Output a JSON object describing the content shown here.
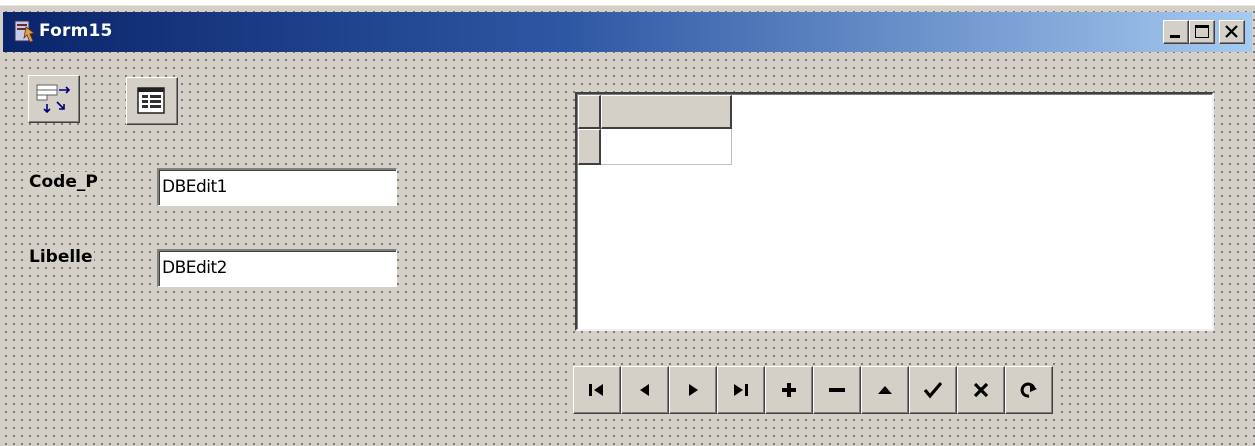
{
  "window": {
    "title": "Form15",
    "caption_buttons": [
      "minimize-icon",
      "maximize-icon",
      "close-icon"
    ]
  },
  "toolbar": {
    "icons": [
      "reorder-fields-icon",
      "table-view-icon"
    ]
  },
  "fields": [
    {
      "label": "Code_P",
      "value": "DBEdit1"
    },
    {
      "label": "Libelle",
      "value": "DBEdit2"
    }
  ],
  "grid": {
    "columns": [
      ""
    ],
    "rows": [
      [
        ""
      ]
    ]
  },
  "navigator": {
    "buttons": [
      {
        "action": "first",
        "icon": "first-record-icon"
      },
      {
        "action": "prior",
        "icon": "prior-record-icon"
      },
      {
        "action": "next",
        "icon": "next-record-icon"
      },
      {
        "action": "last",
        "icon": "last-record-icon"
      },
      {
        "action": "insert",
        "icon": "insert-record-icon"
      },
      {
        "action": "delete",
        "icon": "delete-record-icon"
      },
      {
        "action": "edit",
        "icon": "edit-record-icon"
      },
      {
        "action": "post",
        "icon": "post-record-icon"
      },
      {
        "action": "cancel",
        "icon": "cancel-record-icon"
      },
      {
        "action": "refresh",
        "icon": "refresh-record-icon"
      }
    ]
  },
  "colors": {
    "form_face": "#d4d0c8",
    "title_start": "#0a246a",
    "title_end": "#a6caf0",
    "title_text": "#ffffff"
  }
}
